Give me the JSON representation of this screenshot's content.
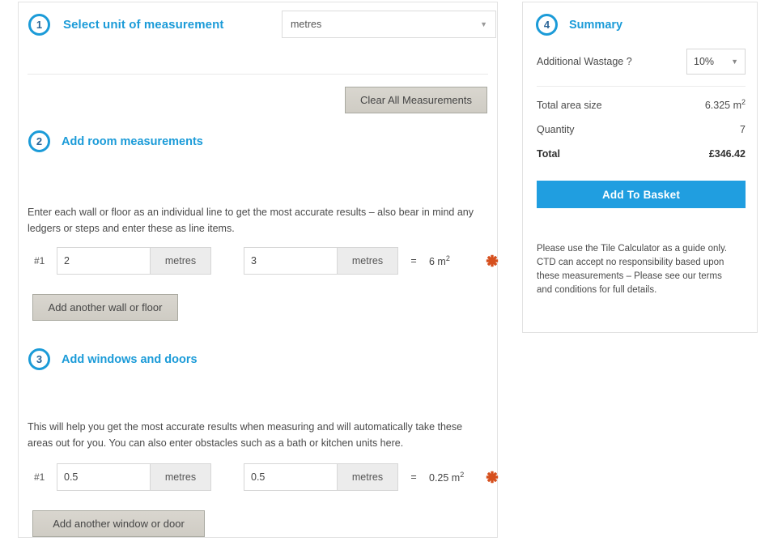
{
  "calculator": {
    "step1": {
      "number": "1",
      "title": "Select unit of measurement",
      "unit_value": "metres",
      "caret": "chevron-down-icon"
    },
    "clear_all_label": "Clear All Measurements",
    "step2": {
      "number": "2",
      "title": "Add room measurements",
      "help_text": "Enter each wall or floor as an individual line to get the most accurate results – also bear in mind any ledgers or steps and enter these as line items.",
      "row": {
        "index": "#1",
        "width_value": "2",
        "width_unit": "metres",
        "length_value": "3",
        "length_unit": "metres",
        "equals": "=",
        "area_number": "6 m",
        "area_exp": "2",
        "delete_icon": "delete-x-icon"
      },
      "add_button_label": "Add another wall or floor"
    },
    "step3": {
      "number": "3",
      "title": "Add windows and doors",
      "help_text": "This will help you get the most accurate results when measuring and will automatically take these areas out for you. You can also enter obstacles such as a bath or kitchen units here.",
      "row": {
        "index": "#1",
        "width_value": "0.5",
        "width_unit": "metres",
        "length_value": "0.5",
        "length_unit": "metres",
        "equals": "=",
        "area_number": "0.25 m",
        "area_exp": "2",
        "delete_icon": "delete-x-icon"
      },
      "add_button_label": "Add another window or door"
    }
  },
  "summary": {
    "number": "4",
    "title": "Summary",
    "wastage_label": "Additional Wastage ?",
    "wastage_value": "10%",
    "rows": [
      {
        "label": "Total area size",
        "value": "6.325 m",
        "exp": "2"
      },
      {
        "label": "Quantity",
        "value": "7",
        "exp": ""
      },
      {
        "label": "Total",
        "value": "£346.42",
        "exp": ""
      }
    ],
    "add_to_basket_label": "Add To Basket",
    "disclaimer": "Please use the Tile Calculator as a guide only. CTD can accept no responsibility based upon these measurements – Please see our terms and conditions for full details."
  },
  "colors": {
    "accent_blue": "#1b9bd8",
    "button_blue": "#209ee0",
    "delete_orange": "#d6501e",
    "grey_button": "#d4d0c8"
  }
}
